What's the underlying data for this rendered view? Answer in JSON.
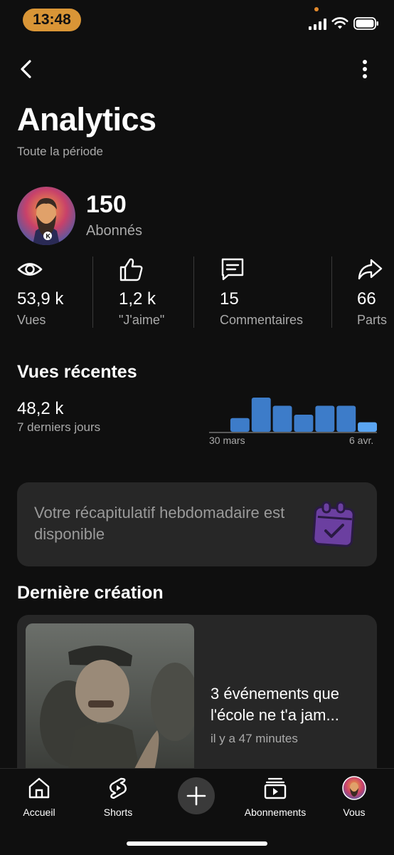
{
  "status_bar": {
    "time": "13:48",
    "icons": [
      "signal-icon",
      "wifi-icon",
      "battery-icon"
    ]
  },
  "header": {
    "back_icon": "chevron-left-icon",
    "more_icon": "more-vertical-icon"
  },
  "page": {
    "title": "Analytics",
    "subtitle": "Toute la période"
  },
  "channel": {
    "subscribers_count": "150",
    "subscribers_label": "Abonnés"
  },
  "stats": [
    {
      "icon": "eye-icon",
      "value": "53,9 k",
      "label": "Vues"
    },
    {
      "icon": "thumbs-up-icon",
      "value": "1,2 k",
      "label": "\"J'aime\""
    },
    {
      "icon": "comment-icon",
      "value": "15",
      "label": "Commentaires"
    },
    {
      "icon": "share-icon",
      "value": "66",
      "label": "Parts"
    }
  ],
  "recent_views": {
    "title": "Vues récentes",
    "value": "48,2 k",
    "period": "7 derniers jours"
  },
  "chart_data": {
    "type": "bar",
    "values": [
      0,
      0.4,
      1.0,
      0.76,
      0.5,
      0.76,
      0.76,
      0.28
    ],
    "start_label": "30 mars",
    "end_label": "6 avr.",
    "colors": {
      "normal": "#3d7cc9",
      "highlight": "#5aa5f2",
      "baseline": "#5a5a5a"
    }
  },
  "recap": {
    "text": "Votre récapitulatif hebdomadaire est disponible",
    "icon": "calendar-check-icon"
  },
  "latest": {
    "section_title": "Dernière création",
    "video_title": "3 événements que l'école ne t'a jam...",
    "time_ago": "il y a 47 minutes"
  },
  "bottom_nav": {
    "items": [
      {
        "label": "Accueil",
        "icon": "home-icon"
      },
      {
        "label": "Shorts",
        "icon": "shorts-icon"
      },
      {
        "label": "Abonnements",
        "icon": "subscriptions-icon"
      },
      {
        "label": "Vous",
        "icon": "avatar"
      }
    ],
    "create_icon": "plus-icon"
  },
  "colors": {
    "accent_pill": "#d99536",
    "card_bg": "#272727",
    "bg": "#0f0f0f",
    "recap_icon": "#6b3fa0"
  }
}
